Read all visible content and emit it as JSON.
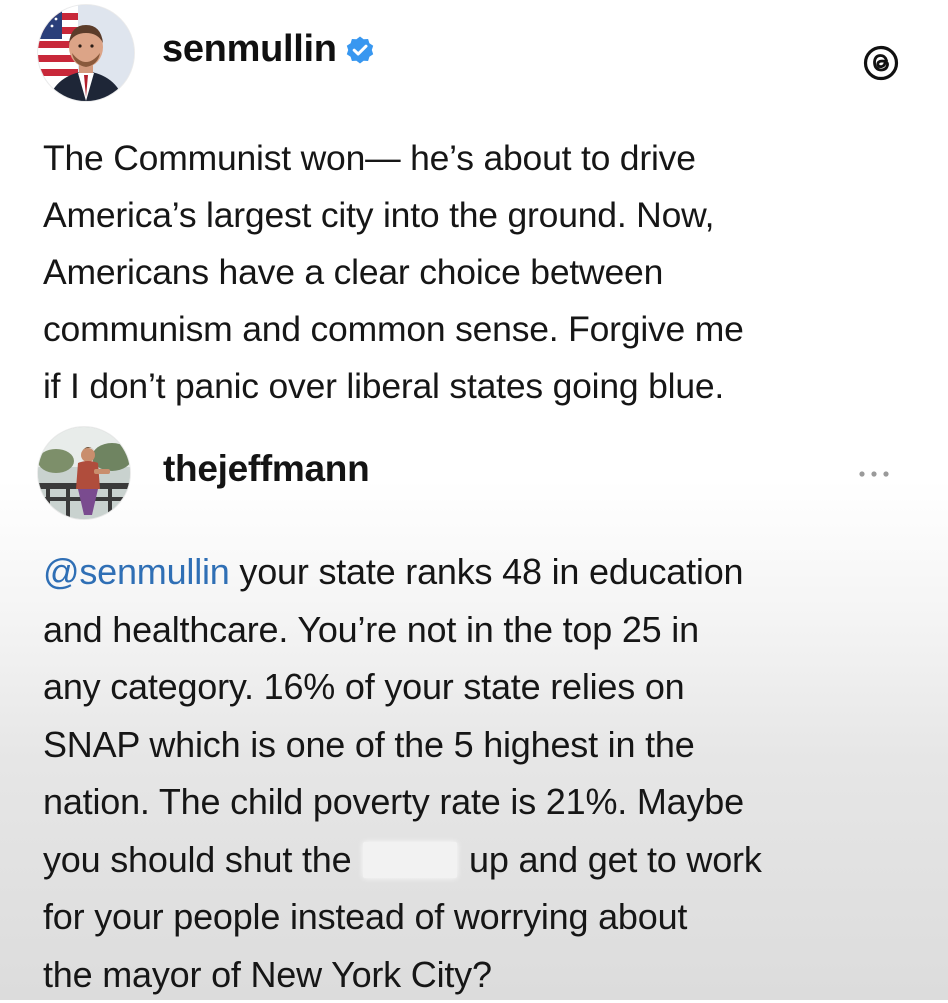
{
  "post1": {
    "username": "senmullin",
    "avatar_icon": "user-portrait-with-flag",
    "verified_icon": "verified-badge-icon",
    "verified_color": "#3897f0",
    "threads_icon": "threads-logo-icon",
    "text_lines": [
      "The Communist won— he’s about to drive",
      "America’s largest city into the ground. Now,",
      "Americans have a clear choice between",
      "communism and common sense. Forgive me",
      "if I don’t panic over liberal states going blue."
    ]
  },
  "post2": {
    "username": "thejeffmann",
    "avatar_icon": "user-portrait-photo",
    "more_icon": "more-options-icon",
    "mention": "@senmullin",
    "mention_color": "#2f6fb5",
    "line1_rest": " your state ranks 48 in education",
    "text_lines": [
      "and healthcare. You’re not in the top 25 in",
      "any category. 16% of your state relies on",
      "SNAP which is one of the 5 highest in the",
      "nation. The child poverty rate is 21%. Maybe"
    ],
    "censor_before": "you should shut the ",
    "censor_after": " up and get to work",
    "text_lines_end": [
      "for your people instead of worrying about",
      "the mayor of New York City?"
    ]
  }
}
